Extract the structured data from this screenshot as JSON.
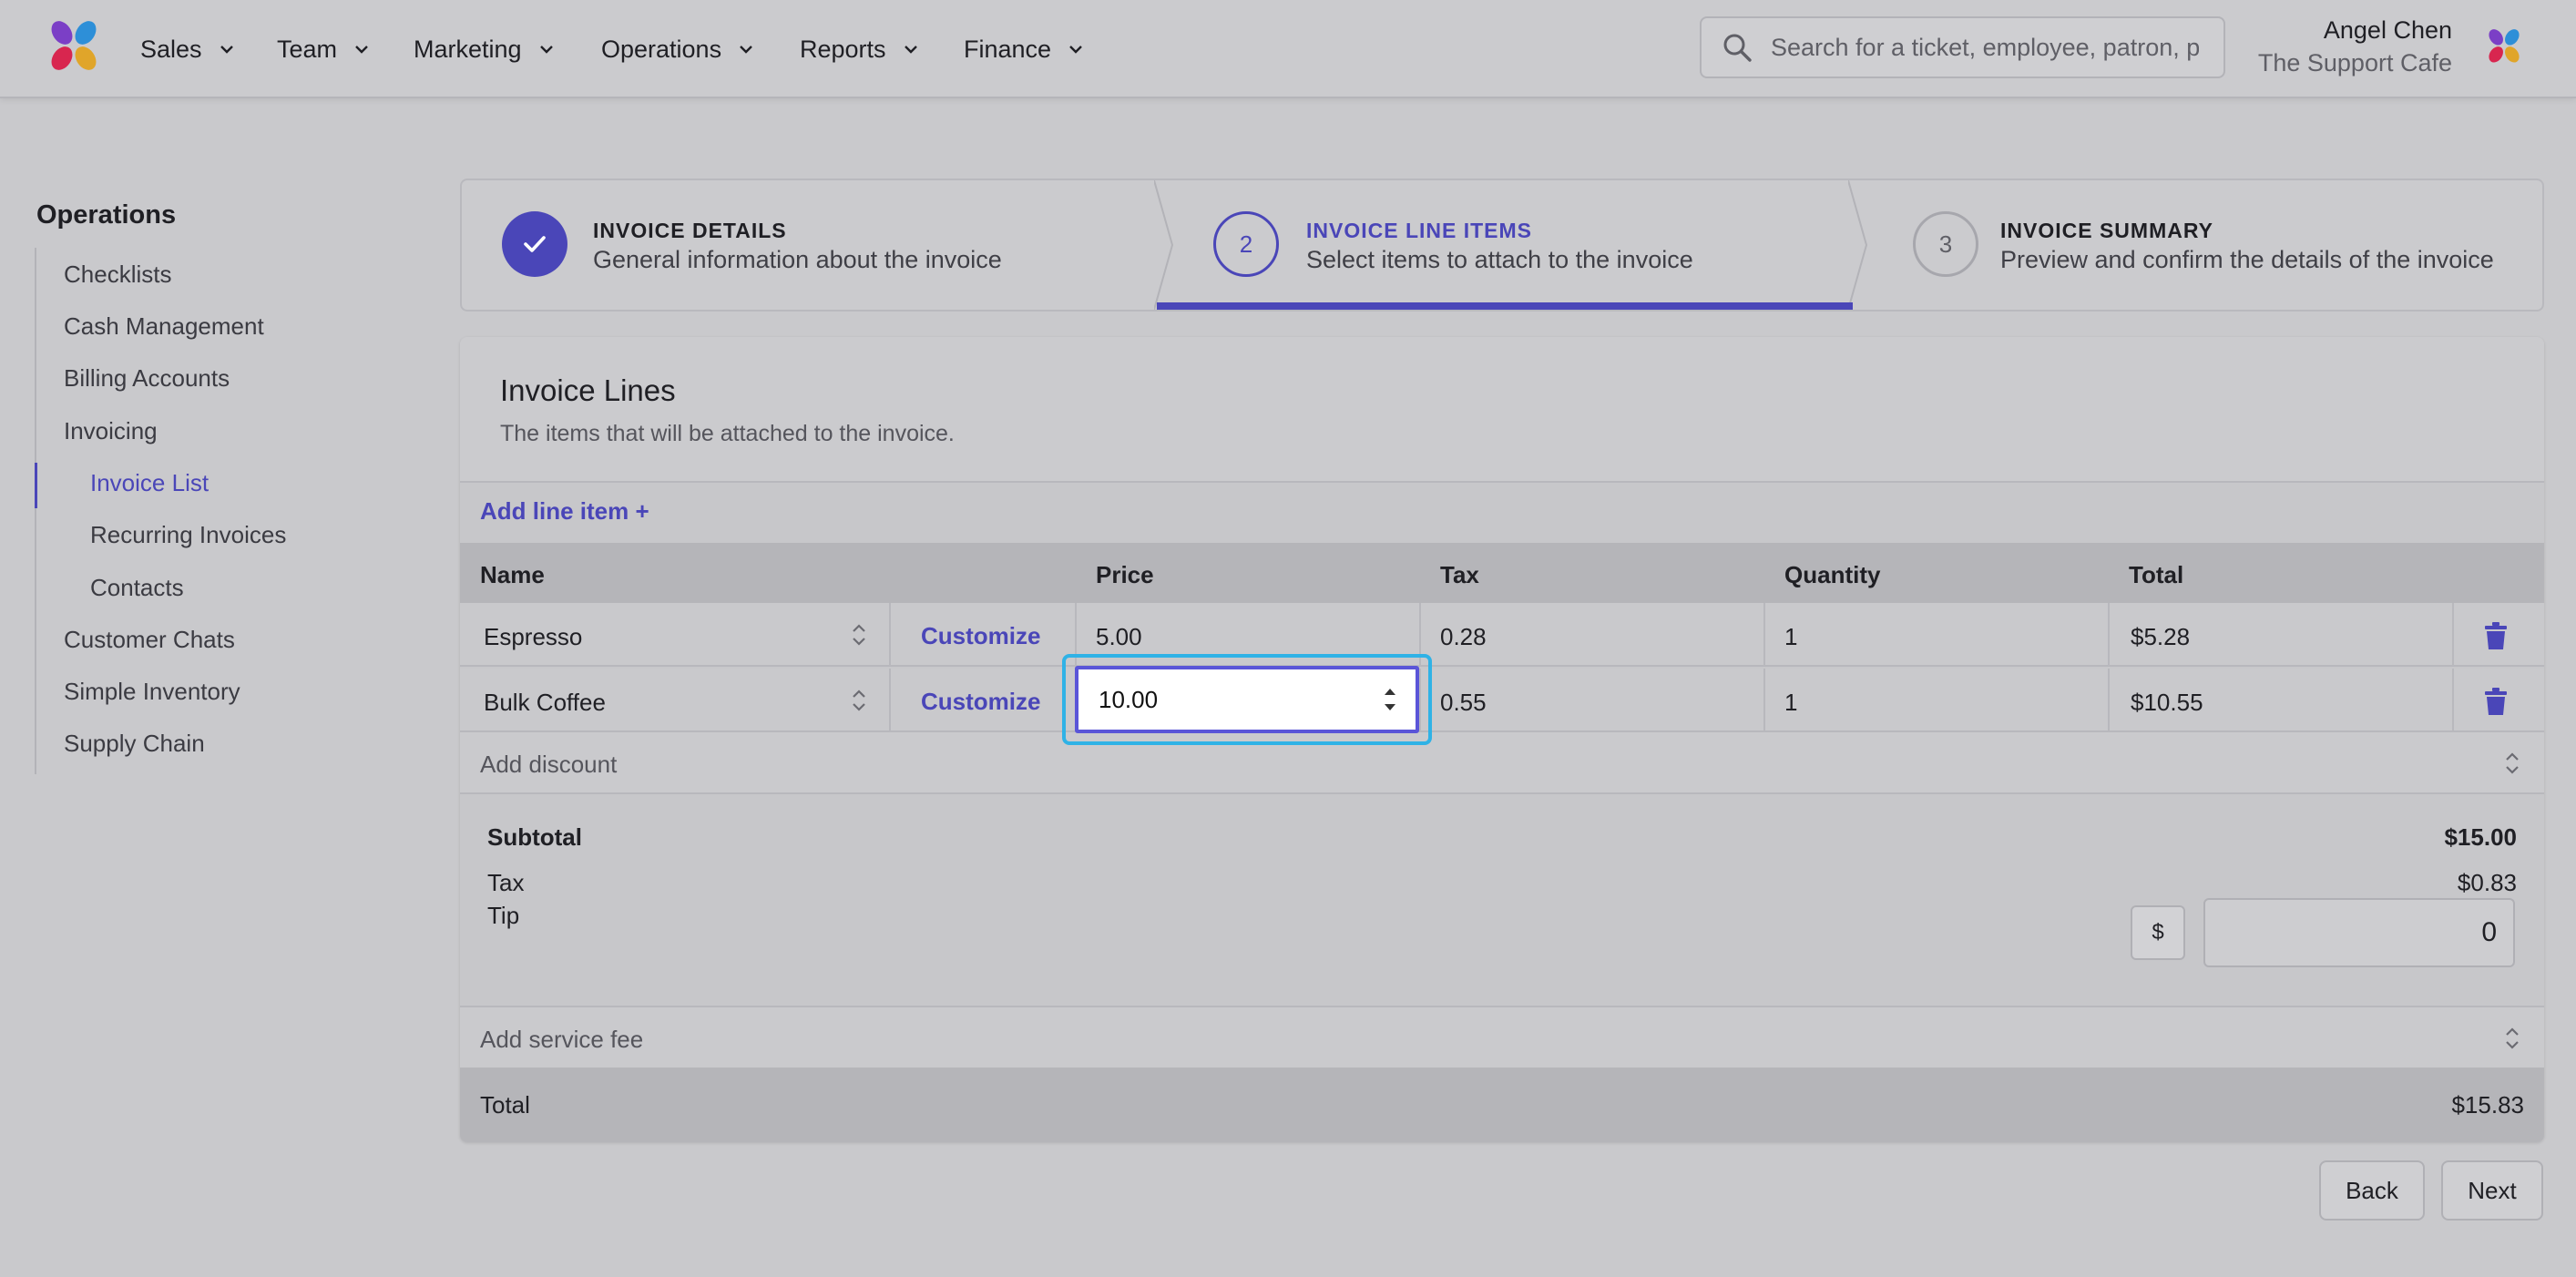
{
  "header": {
    "nav": [
      {
        "label": "Sales"
      },
      {
        "label": "Team"
      },
      {
        "label": "Marketing"
      },
      {
        "label": "Operations"
      },
      {
        "label": "Reports"
      },
      {
        "label": "Finance"
      }
    ],
    "search_placeholder": "Search for a ticket, employee, patron, p",
    "user_name": "Angel Chen",
    "user_org": "The Support Cafe"
  },
  "sidebar": {
    "title": "Operations",
    "items": [
      {
        "label": "Checklists"
      },
      {
        "label": "Cash Management"
      },
      {
        "label": "Billing Accounts"
      },
      {
        "label": "Invoicing"
      },
      {
        "label": "Invoice List"
      },
      {
        "label": "Recurring Invoices"
      },
      {
        "label": "Contacts"
      },
      {
        "label": "Customer Chats"
      },
      {
        "label": "Simple Inventory"
      },
      {
        "label": "Supply Chain"
      }
    ]
  },
  "steps": [
    {
      "number": "",
      "title": "INVOICE DETAILS",
      "subtitle": "General information about the invoice"
    },
    {
      "number": "2",
      "title": "INVOICE LINE ITEMS",
      "subtitle": "Select items to attach to the invoice"
    },
    {
      "number": "3",
      "title": "INVOICE SUMMARY",
      "subtitle": "Preview and confirm the details of the invoice"
    }
  ],
  "invoice": {
    "title": "Invoice Lines",
    "subtitle": "The items that will be attached to the invoice.",
    "add_line_label": "Add line item +",
    "columns": {
      "name": "Name",
      "price": "Price",
      "tax": "Tax",
      "quantity": "Quantity",
      "total": "Total"
    },
    "customize_label": "Customize",
    "rows": [
      {
        "name": "Espresso",
        "price": "5.00",
        "tax": "0.28",
        "quantity": "1",
        "total": "$5.28"
      },
      {
        "name": "Bulk Coffee",
        "price": "10.00",
        "tax": "0.55",
        "quantity": "1",
        "total": "$10.55"
      }
    ],
    "add_discount_label": "Add discount",
    "subtotal_label": "Subtotal",
    "subtotal_value": "$15.00",
    "tax_label": "Tax",
    "tax_value": "$0.83",
    "tip_label": "Tip",
    "tip_currency": "$",
    "tip_value": "0",
    "add_service_fee_label": "Add service fee",
    "total_label": "Total",
    "total_value": "$15.83"
  },
  "buttons": {
    "back": "Back",
    "next": "Next"
  },
  "colors": {
    "accent": "#4a46b8",
    "focus": "#2fb2e6"
  }
}
